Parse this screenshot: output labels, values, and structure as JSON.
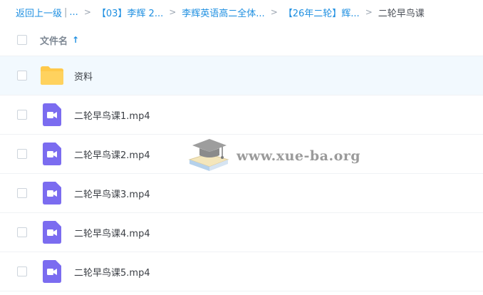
{
  "breadcrumb": {
    "back": "返回上一级",
    "pipe": "|",
    "ellipsis": "...",
    "items": [
      "【03】李辉 2...",
      "李辉英语高二全体...",
      "【26年二轮】辉..."
    ],
    "current": "二轮早鸟课",
    "separator": ">"
  },
  "header": {
    "column_name": "文件名",
    "sort_icon": "arrow-up-icon"
  },
  "files": [
    {
      "name": "资料",
      "icon": "folder-icon"
    },
    {
      "name": "二轮早鸟课1.mp4",
      "icon": "video-icon"
    },
    {
      "name": "二轮早鸟课2.mp4",
      "icon": "video-icon"
    },
    {
      "name": "二轮早鸟课3.mp4",
      "icon": "video-icon"
    },
    {
      "name": "二轮早鸟课4.mp4",
      "icon": "video-icon"
    },
    {
      "name": "二轮早鸟课5.mp4",
      "icon": "video-icon"
    }
  ],
  "watermark": {
    "text": "www.xue-ba.org"
  },
  "colors": {
    "link": "#1e8fe1",
    "folder": "#ffc94a",
    "video": "#7b6cf0",
    "row_hover": "#f2f9fe"
  }
}
